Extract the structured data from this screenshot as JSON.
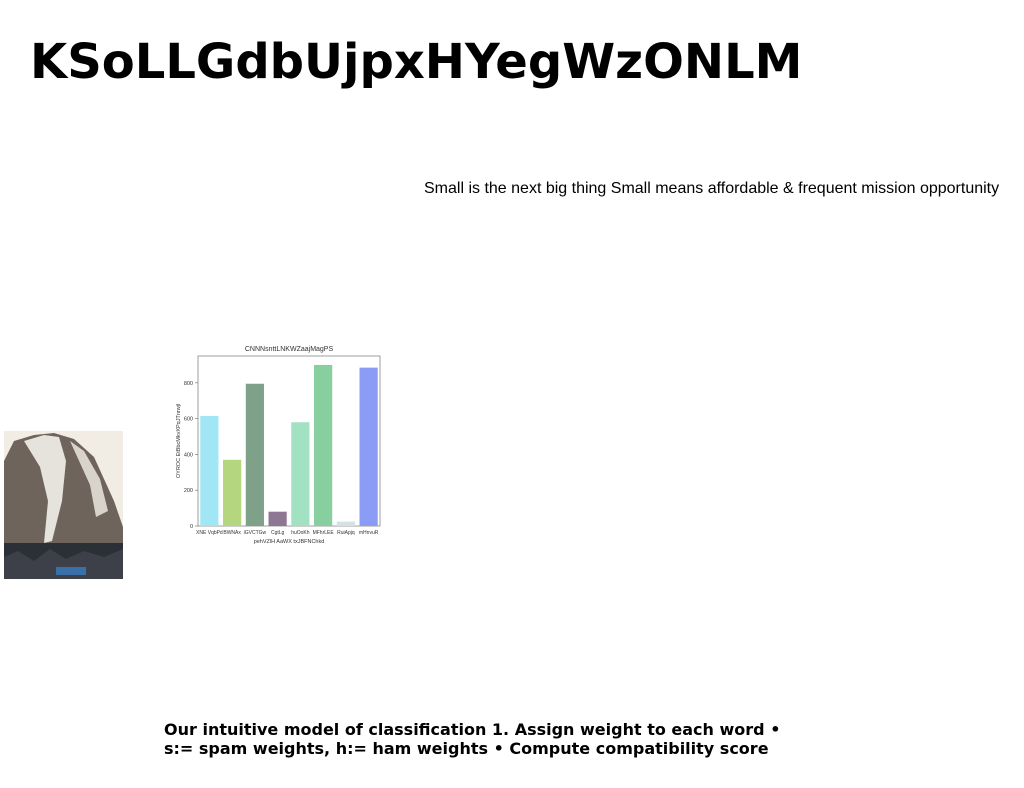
{
  "title": "KSoLLGdbUjpxHYegWzONLM",
  "tagline": "Small is the next big thing Small means affordable & frequent mission opportunity",
  "photo": {
    "icon": "mountain-photo-icon",
    "colors": {
      "sky": "#f2ede4",
      "rock": "#6e645c",
      "snow": "#e6e2dc",
      "ground": "#2b2f36",
      "accent": "#3a6fa8"
    }
  },
  "caption": "Our intuitive model of classification 1. Assign weight to each word • s:= spam weights, h:= ham weights • Compute compatibility score",
  "chart_data": {
    "type": "bar",
    "title": "CNNNsnttLNKWZaajMagPS",
    "xlabel": "pehVZlH AaWX txJBFNChkd",
    "ylabel": "OYROC EtBbcMkvXPqJTnrwjl",
    "categories": [
      "XNE VqbPd",
      "BWNAx",
      "iGVCTGw",
      "CgtLg",
      "huOoKh",
      "MFhrLEE",
      "RuiApjq",
      "mHnvuR"
    ],
    "values": [
      615,
      370,
      795,
      80,
      580,
      900,
      25,
      885
    ],
    "colors": [
      "#a1e6f5",
      "#b3d67e",
      "#7fa089",
      "#8e7792",
      "#a3e1c3",
      "#88cfa0",
      "#d3e3e4",
      "#8a9cf5"
    ],
    "ylim": [
      0,
      950
    ],
    "yticks": [
      0,
      200,
      400,
      600,
      800
    ],
    "grid": false
  }
}
